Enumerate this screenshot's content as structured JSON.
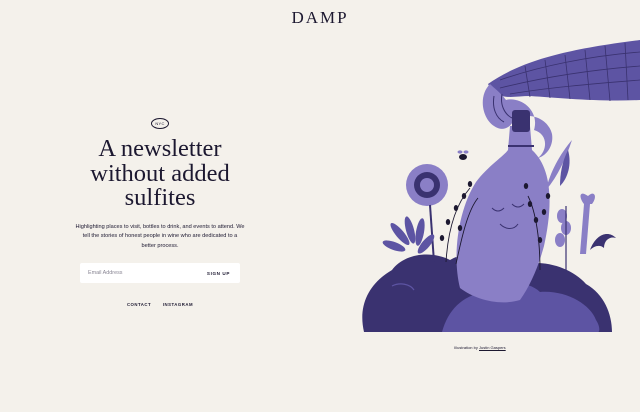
{
  "header": {
    "logo": "DAMP"
  },
  "hero": {
    "badge": "NYC",
    "title_line1": "A newsletter",
    "title_line2": "without added",
    "title_line3": "sulfites",
    "description": "Highlighting places to visit, bottles to drink, and events to attend. We tell the stories of honest people in wine who are dedicated to a better process."
  },
  "form": {
    "email_placeholder": "Email Address",
    "signup_label": "SIGN UP"
  },
  "footer_links": {
    "contact": "CONTACT",
    "instagram": "INSTAGRAM"
  },
  "credit": {
    "prefix": "Illustration by",
    "author": "Justin Gaspers"
  },
  "colors": {
    "background": "#f4f1eb",
    "ink": "#1c1830",
    "lavender": "#8a7fc6",
    "dark_purple": "#3a3270",
    "mid_purple": "#5d54a3"
  },
  "illustration": {
    "icon": "wine-bottle-illustration"
  }
}
